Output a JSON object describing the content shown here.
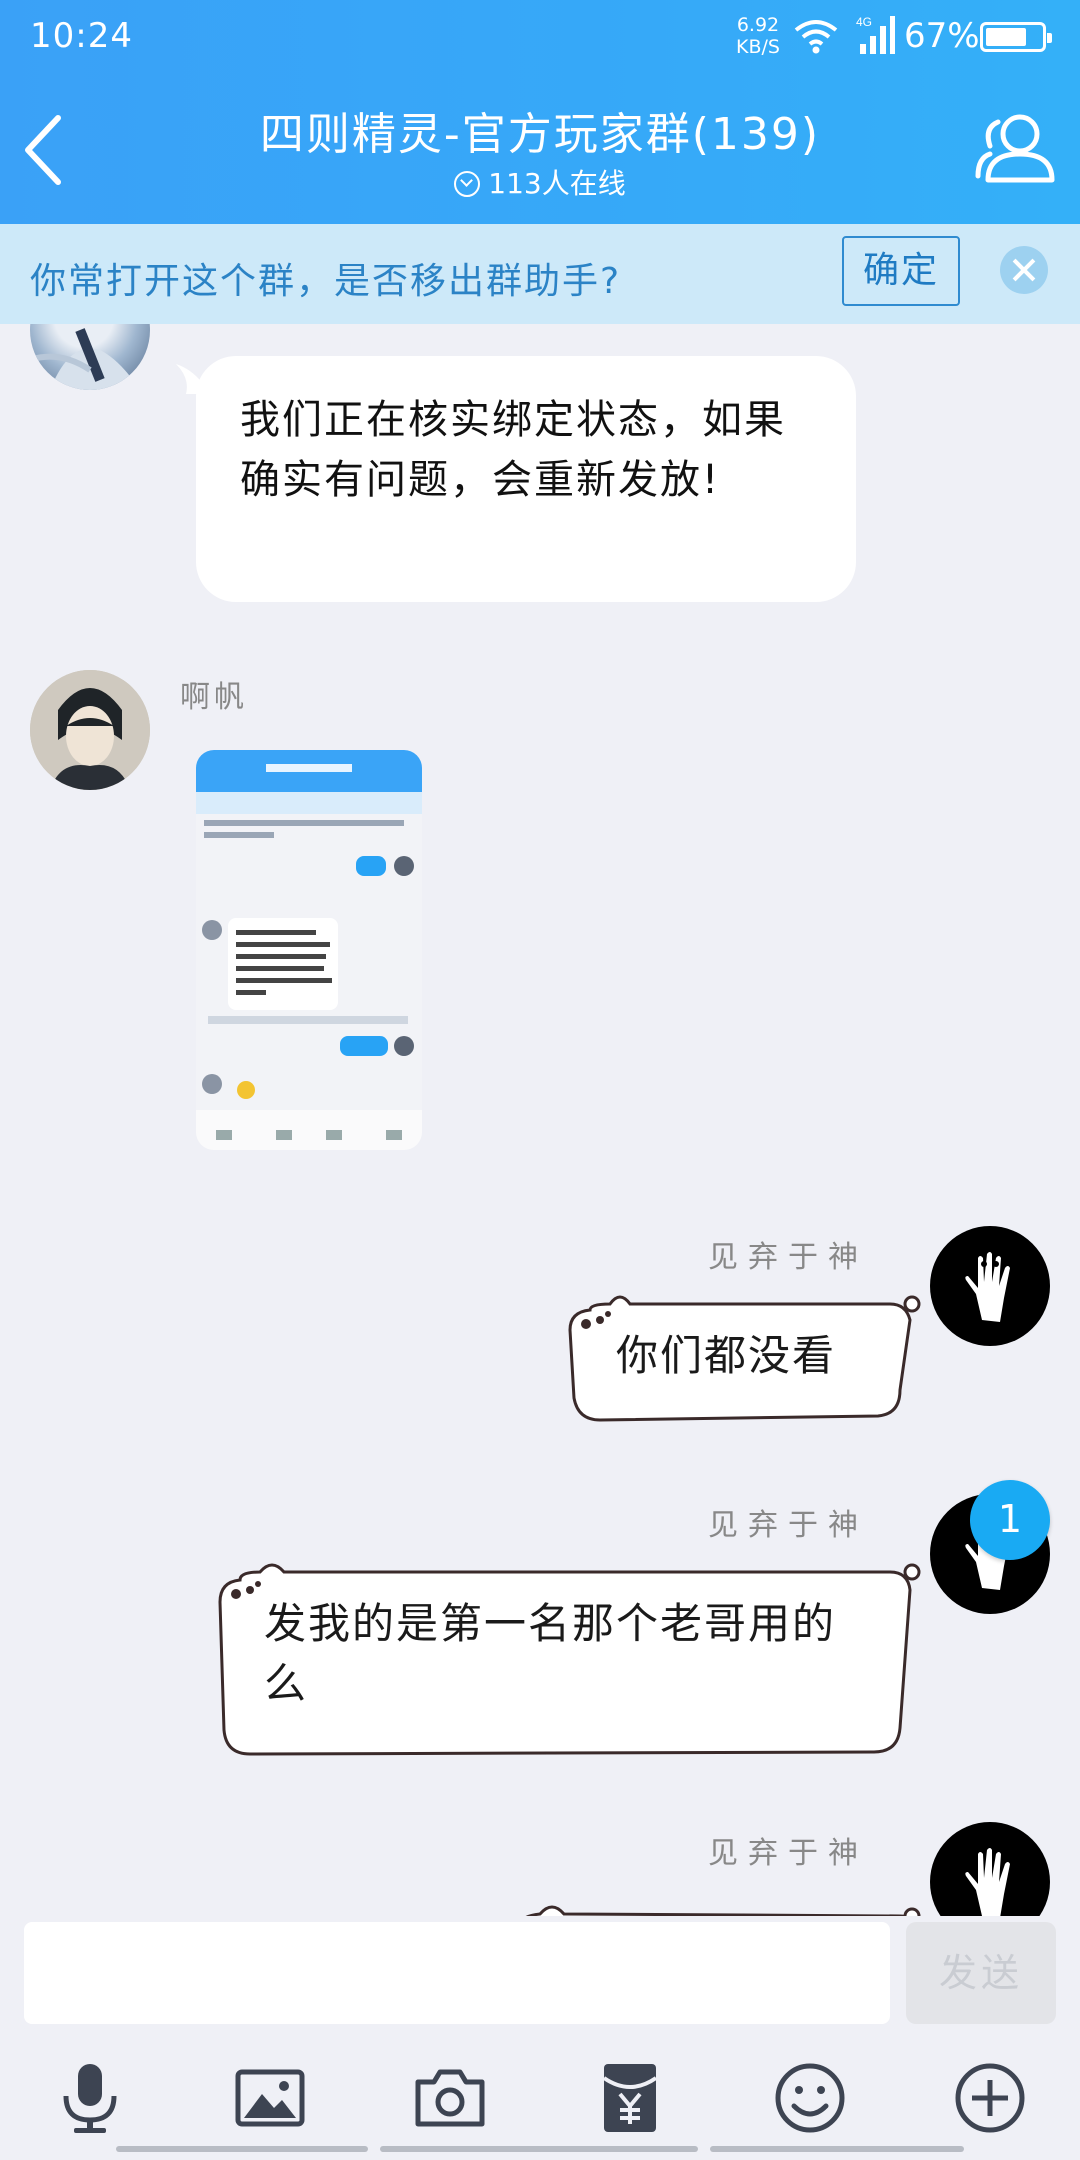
{
  "status_bar": {
    "time": "10:24",
    "net_speed_value": "6.92",
    "net_speed_unit": "KB/S",
    "network": "4G",
    "battery": "67%"
  },
  "header": {
    "title": "四则精灵-官方玩家群(139)",
    "online": "113人在线"
  },
  "banner": {
    "text": "你常打开这个群，是否移出群助手?",
    "confirm": "确定"
  },
  "messages": [
    {
      "text": "我们正在核实绑定状态，如果确实有问题，会重新发放!"
    },
    {
      "sender": "啊帆",
      "type": "image"
    },
    {
      "sender": "见弃于神",
      "text": "你们都没看"
    },
    {
      "sender": "见弃于神",
      "text": "发我的是第一名那个老哥用的么"
    },
    {
      "sender": "见弃于神",
      "text": ""
    }
  ],
  "new_message_badge": "1",
  "input": {
    "send_label": "发送"
  },
  "toolbar": [
    "mic-icon",
    "image-icon",
    "camera-icon",
    "red-packet-icon",
    "emoji-icon",
    "plus-icon"
  ],
  "colors": {
    "header": "#38a6f8",
    "banner": "#cde9f9",
    "accent": "#1f7bc3",
    "badge": "#19aaf3"
  }
}
